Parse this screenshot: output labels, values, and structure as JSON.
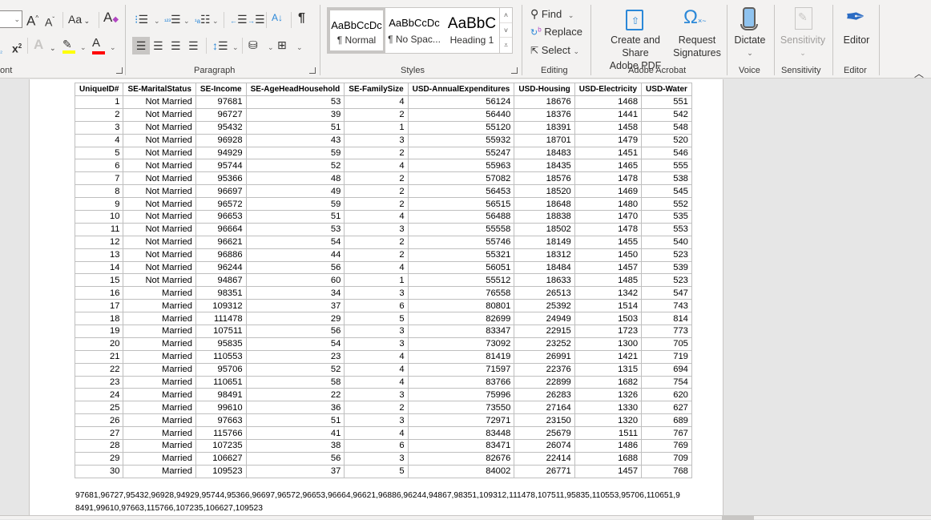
{
  "ribbon": {
    "groups": {
      "font": "ont",
      "paragraph": "Paragraph",
      "styles": "Styles",
      "editing": "Editing",
      "adobe_acrobat": "Adobe Acrobat",
      "voice": "Voice",
      "sensitivity": "Sensitivity",
      "editor": "Editor"
    },
    "font": {
      "grow_font": "A",
      "shrink_font": "A",
      "change_case": "Aa",
      "superscript": "x",
      "text_effects": "A",
      "font_color": "A",
      "highlight_color": "#ffff00",
      "font_color_value": "#ff0000"
    },
    "paragraph": {
      "pilcrow": "¶",
      "sort": "A↓"
    },
    "styles": [
      {
        "preview": "AaBbCcDc",
        "name": "¶ Normal",
        "selected": true
      },
      {
        "preview": "AaBbCcDc",
        "name": "¶ No Spac...",
        "selected": false
      },
      {
        "preview": "AaBbC",
        "name": "Heading 1",
        "selected": false
      }
    ],
    "editing": {
      "find": "Find",
      "replace": "Replace",
      "select": "Select"
    },
    "acrobat": {
      "create_share_line1": "Create and Share",
      "create_share_line2": "Adobe PDF",
      "request_line1": "Request",
      "request_line2": "Signatures"
    },
    "voice": {
      "dictate": "Dictate"
    },
    "sensitivity": {
      "label": "Sensitivity"
    },
    "editor": {
      "label": "Editor"
    }
  },
  "table": {
    "headers": [
      "UniqueID#",
      "SE-MaritalStatus",
      "SE-Income",
      "SE-AgeHeadHousehold",
      "SE-FamilySize",
      "USD-AnnualExpenditures",
      "USD-Housing",
      "USD-Electricity",
      "USD-Water"
    ],
    "rows": [
      [
        "1",
        "Not Married",
        "97681",
        "53",
        "4",
        "56124",
        "18676",
        "1468",
        "551"
      ],
      [
        "2",
        "Not Married",
        "96727",
        "39",
        "2",
        "56440",
        "18376",
        "1441",
        "542"
      ],
      [
        "3",
        "Not Married",
        "95432",
        "51",
        "1",
        "55120",
        "18391",
        "1458",
        "548"
      ],
      [
        "4",
        "Not Married",
        "96928",
        "43",
        "3",
        "55932",
        "18701",
        "1479",
        "520"
      ],
      [
        "5",
        "Not Married",
        "94929",
        "59",
        "2",
        "55247",
        "18483",
        "1451",
        "546"
      ],
      [
        "6",
        "Not Married",
        "95744",
        "52",
        "4",
        "55963",
        "18435",
        "1465",
        "555"
      ],
      [
        "7",
        "Not Married",
        "95366",
        "48",
        "2",
        "57082",
        "18576",
        "1478",
        "538"
      ],
      [
        "8",
        "Not Married",
        "96697",
        "49",
        "2",
        "56453",
        "18520",
        "1469",
        "545"
      ],
      [
        "9",
        "Not Married",
        "96572",
        "59",
        "2",
        "56515",
        "18648",
        "1480",
        "552"
      ],
      [
        "10",
        "Not Married",
        "96653",
        "51",
        "4",
        "56488",
        "18838",
        "1470",
        "535"
      ],
      [
        "11",
        "Not Married",
        "96664",
        "53",
        "3",
        "55558",
        "18502",
        "1478",
        "553"
      ],
      [
        "12",
        "Not Married",
        "96621",
        "54",
        "2",
        "55746",
        "18149",
        "1455",
        "540"
      ],
      [
        "13",
        "Not Married",
        "96886",
        "44",
        "2",
        "55321",
        "18312",
        "1450",
        "523"
      ],
      [
        "14",
        "Not Married",
        "96244",
        "56",
        "4",
        "56051",
        "18484",
        "1457",
        "539"
      ],
      [
        "15",
        "Not Married",
        "94867",
        "60",
        "1",
        "55512",
        "18633",
        "1485",
        "523"
      ],
      [
        "16",
        "Married",
        "98351",
        "34",
        "3",
        "76558",
        "26513",
        "1342",
        "547"
      ],
      [
        "17",
        "Married",
        "109312",
        "37",
        "6",
        "80801",
        "25392",
        "1514",
        "743"
      ],
      [
        "18",
        "Married",
        "111478",
        "29",
        "5",
        "82699",
        "24949",
        "1503",
        "814"
      ],
      [
        "19",
        "Married",
        "107511",
        "56",
        "3",
        "83347",
        "22915",
        "1723",
        "773"
      ],
      [
        "20",
        "Married",
        "95835",
        "54",
        "3",
        "73092",
        "23252",
        "1300",
        "705"
      ],
      [
        "21",
        "Married",
        "110553",
        "23",
        "4",
        "81419",
        "26991",
        "1421",
        "719"
      ],
      [
        "22",
        "Married",
        "95706",
        "52",
        "4",
        "71597",
        "22376",
        "1315",
        "694"
      ],
      [
        "23",
        "Married",
        "110651",
        "58",
        "4",
        "83766",
        "22899",
        "1682",
        "754"
      ],
      [
        "24",
        "Married",
        "98491",
        "22",
        "3",
        "75996",
        "26283",
        "1326",
        "620"
      ],
      [
        "25",
        "Married",
        "99610",
        "36",
        "2",
        "73550",
        "27164",
        "1330",
        "627"
      ],
      [
        "26",
        "Married",
        "97663",
        "51",
        "3",
        "72971",
        "23150",
        "1320",
        "689"
      ],
      [
        "27",
        "Married",
        "115766",
        "41",
        "4",
        "83448",
        "25679",
        "1511",
        "767"
      ],
      [
        "28",
        "Married",
        "107235",
        "38",
        "6",
        "83471",
        "26074",
        "1486",
        "769"
      ],
      [
        "29",
        "Married",
        "106627",
        "56",
        "3",
        "82676",
        "22414",
        "1688",
        "709"
      ],
      [
        "30",
        "Married",
        "109523",
        "37",
        "5",
        "84002",
        "26771",
        "1457",
        "768"
      ]
    ]
  },
  "csv_text": "97681,96727,95432,96928,94929,95744,95366,96697,96572,96653,96664,96621,96886,96244,94867,98351,109312,111478,107511,95835,110553,95706,110651,98491,99610,97663,115766,107235,106627,109523"
}
